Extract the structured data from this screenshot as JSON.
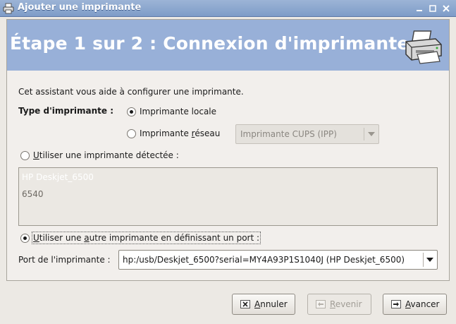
{
  "window": {
    "title": "Ajouter une imprimante"
  },
  "banner": {
    "title": "Étape 1 sur 2 : Connexion d'imprimante"
  },
  "intro": "Cet assistant vous aide à configurer une imprimante.",
  "printer_type": {
    "label": "Type d'imprimante :",
    "local": {
      "label": "Imprimante locale",
      "checked": true
    },
    "network": {
      "label_pre": "Imprimante ",
      "label_u": "r",
      "label_post": "éseau",
      "checked": false
    },
    "network_protocol": "Imprimante CUPS (IPP)"
  },
  "detected": {
    "label_u": "U",
    "label_post": "tiliser une imprimante détectée :",
    "checked": false,
    "items": [
      "HP Deskjet_6500",
      "6540"
    ]
  },
  "other_port": {
    "label_u": "U",
    "label_post": "tiliser une ",
    "label_u2": "a",
    "label_post2": "utre imprimante en définissant un port :",
    "checked": true
  },
  "port": {
    "label": "Port de l'imprimante :",
    "value": "hp:/usb/Deskjet_6500?serial=MY4A93P1S1040J (HP Deskjet_6500)"
  },
  "buttons": {
    "cancel": {
      "u": "A",
      "rest": "nnuler"
    },
    "back": {
      "u": "R",
      "rest": "evenir"
    },
    "next": {
      "u": "A",
      "rest": "vancer"
    }
  }
}
